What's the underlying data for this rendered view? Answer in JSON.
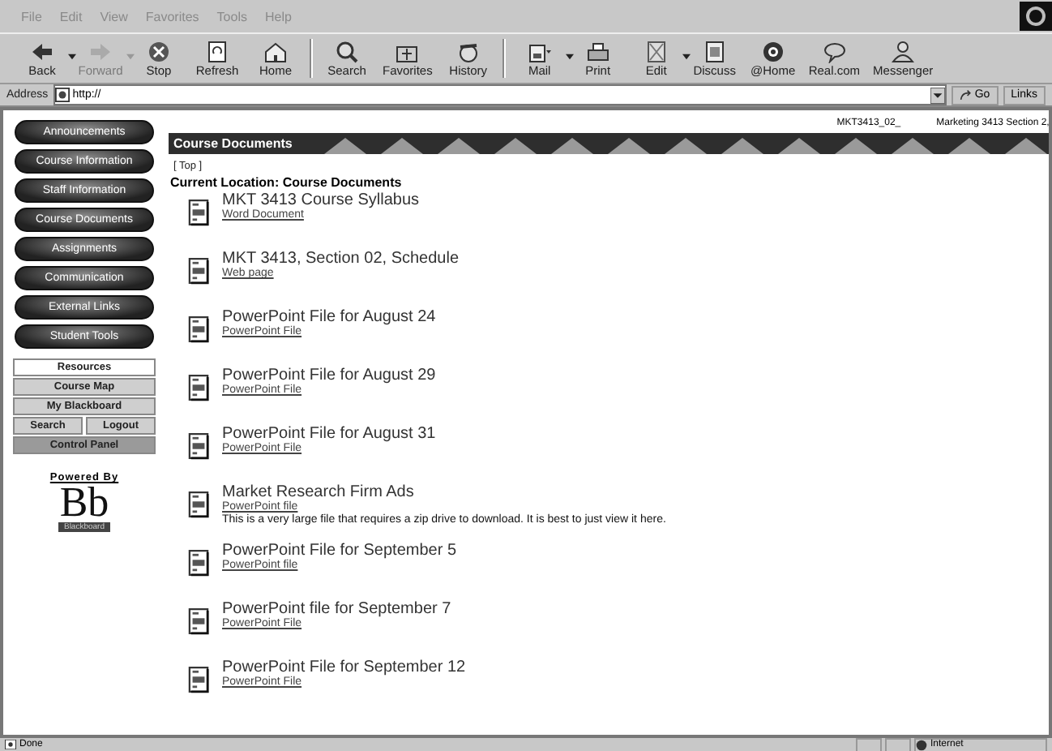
{
  "menu_bar": [
    "File",
    "Edit",
    "View",
    "Favorites",
    "Tools",
    "Help"
  ],
  "toolbar": [
    {
      "label": "Back",
      "dropdown": true,
      "disabled": false
    },
    {
      "label": "Forward",
      "dropdown": true,
      "disabled": true
    },
    {
      "label": "Stop",
      "dropdown": false,
      "disabled": false
    },
    {
      "label": "Refresh",
      "dropdown": false,
      "disabled": false
    },
    {
      "label": "Home",
      "dropdown": false,
      "disabled": false
    },
    {
      "label": "Search",
      "dropdown": false,
      "disabled": false
    },
    {
      "label": "Favorites",
      "dropdown": false,
      "disabled": false
    },
    {
      "label": "History",
      "dropdown": false,
      "disabled": false
    },
    {
      "label": "Mail",
      "dropdown": true,
      "disabled": false
    },
    {
      "label": "Print",
      "dropdown": false,
      "disabled": false
    },
    {
      "label": "Edit",
      "dropdown": true,
      "disabled": false
    },
    {
      "label": "Discuss",
      "dropdown": false,
      "disabled": false
    },
    {
      "label": "@Home",
      "dropdown": false,
      "disabled": false
    },
    {
      "label": "Real.com",
      "dropdown": false,
      "disabled": false
    },
    {
      "label": "Messenger",
      "dropdown": false,
      "disabled": false
    }
  ],
  "address_bar": {
    "label": "Address",
    "value": "http://",
    "go": "Go",
    "links": "Links"
  },
  "sidebar": {
    "nav_buttons": [
      "Announcements",
      "Course Information",
      "Staff Information",
      "Course Documents",
      "Assignments",
      "Communication",
      "External Links",
      "Student Tools"
    ],
    "tool_rows": [
      {
        "items": [
          {
            "label": "Resources",
            "kind": "current"
          }
        ]
      },
      {
        "items": [
          {
            "label": "Course Map",
            "kind": "link"
          }
        ]
      },
      {
        "items": [
          {
            "label": "My Blackboard",
            "kind": "link"
          }
        ]
      },
      {
        "items": [
          {
            "label": "Search",
            "kind": "link"
          },
          {
            "label": "Logout",
            "kind": "link"
          }
        ]
      },
      {
        "items": [
          {
            "label": "Control Panel",
            "kind": "admin"
          }
        ]
      }
    ],
    "powered_by": "Powered By",
    "logo": "Bb",
    "logo_caption": "Blackboard"
  },
  "course_header": {
    "course_id": "MKT3413_02_",
    "course_name": "Marketing 3413 Section 2,"
  },
  "banner": "Course Documents",
  "top_link": "[ Top ]",
  "location": "Current Location: Course Documents",
  "documents": [
    {
      "title": "MKT 3413 Course Syllabus",
      "type": "Word Document"
    },
    {
      "title": "MKT 3413, Section 02, Schedule",
      "type": "Web page"
    },
    {
      "title": "PowerPoint File for August 24",
      "type": "PowerPoint File"
    },
    {
      "title": "PowerPoint File for August 29",
      "type": "PowerPoint File"
    },
    {
      "title": "PowerPoint File for August 31",
      "type": "PowerPoint File"
    },
    {
      "title": "Market Research Firm Ads",
      "type": "PowerPoint file",
      "description": "This is a very large file that requires a zip drive to download. It is best to just view it here."
    },
    {
      "title": "PowerPoint File for September 5",
      "type": "PowerPoint file"
    },
    {
      "title": "PowerPoint file for September 7",
      "type": "PowerPoint File"
    },
    {
      "title": "PowerPoint File for September 12",
      "type": "PowerPoint File"
    }
  ],
  "status_bar": {
    "text": "Done",
    "zone": "Internet"
  }
}
